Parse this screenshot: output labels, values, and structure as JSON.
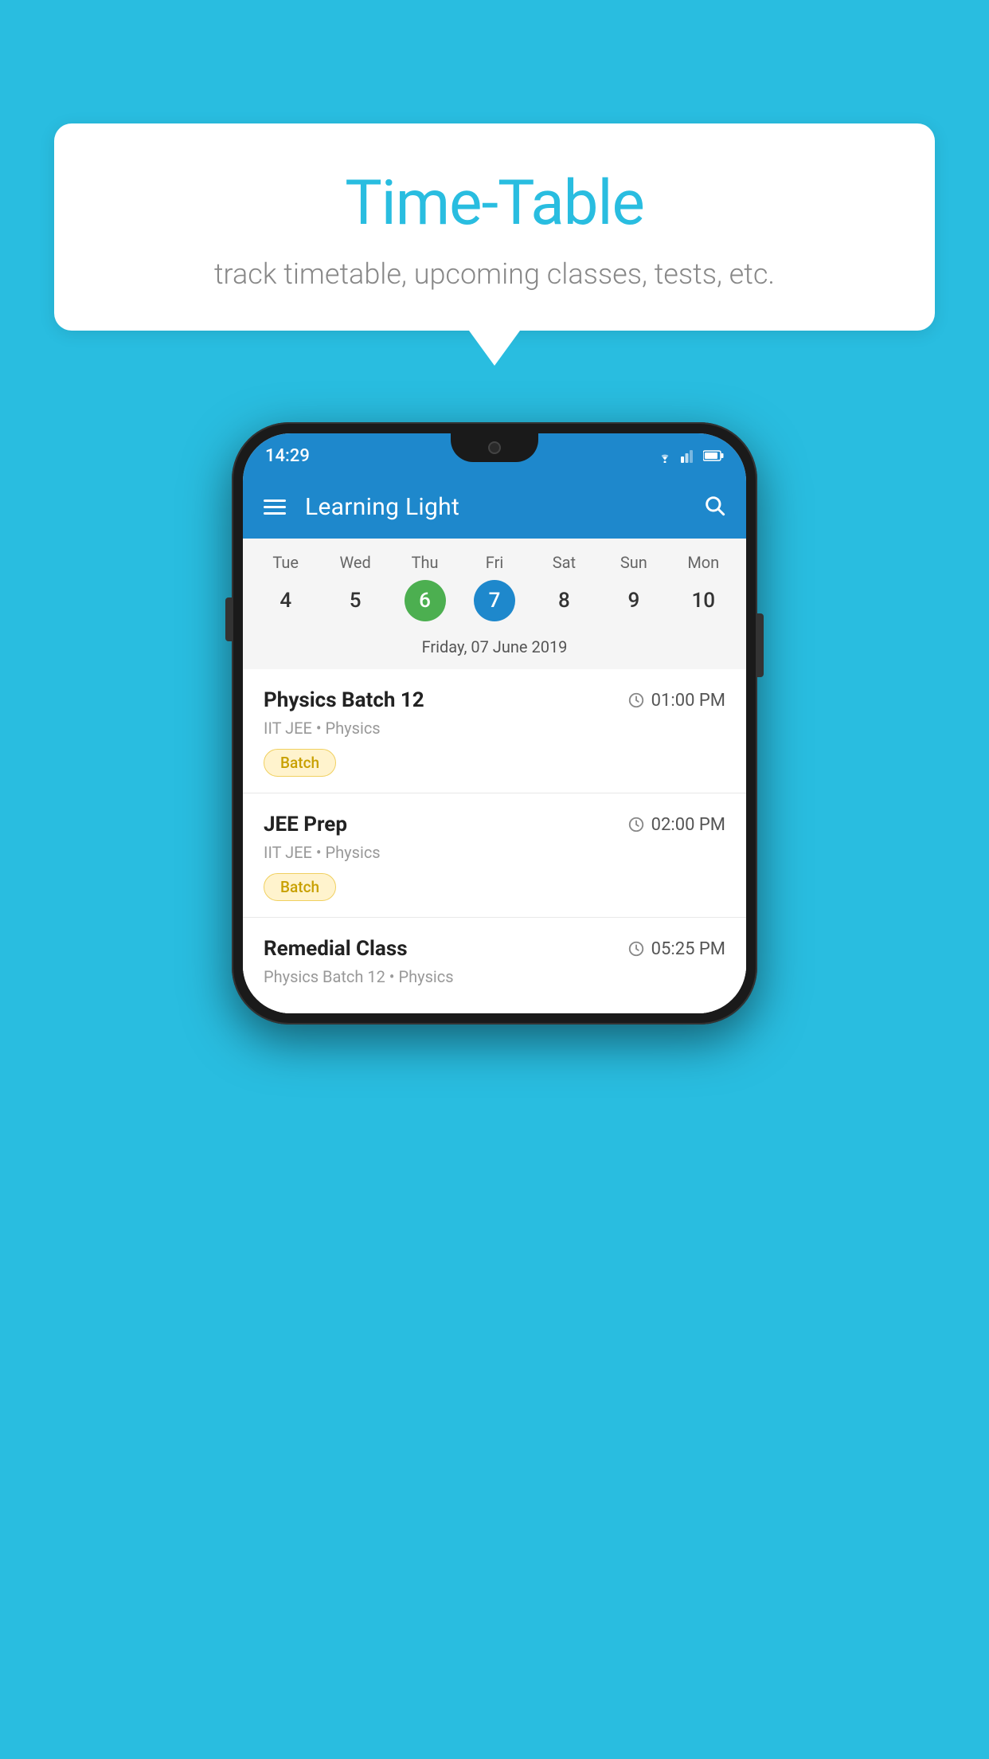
{
  "background": {
    "color": "#29bde0"
  },
  "speech_bubble": {
    "title": "Time-Table",
    "subtitle": "track timetable, upcoming classes, tests, etc."
  },
  "phone": {
    "status_bar": {
      "time": "14:29"
    },
    "app_bar": {
      "title": "Learning Light"
    },
    "calendar": {
      "days_of_week": [
        "Tue",
        "Wed",
        "Thu",
        "Fri",
        "Sat",
        "Sun",
        "Mon"
      ],
      "dates": [
        "4",
        "5",
        "6",
        "7",
        "8",
        "9",
        "10"
      ],
      "today_index": 2,
      "selected_index": 3,
      "selected_date_label": "Friday, 07 June 2019"
    },
    "classes": [
      {
        "name": "Physics Batch 12",
        "time": "01:00 PM",
        "meta": "IIT JEE • Physics",
        "badge": "Batch"
      },
      {
        "name": "JEE Prep",
        "time": "02:00 PM",
        "meta": "IIT JEE • Physics",
        "badge": "Batch"
      },
      {
        "name": "Remedial Class",
        "time": "05:25 PM",
        "meta": "Physics Batch 12 • Physics",
        "badge": ""
      }
    ]
  }
}
